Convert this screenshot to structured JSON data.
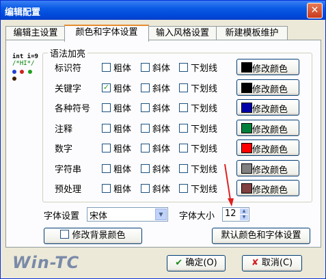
{
  "window": {
    "title": "编辑配置",
    "close_glyph": "✕"
  },
  "tabs": [
    {
      "label": "编辑主设置"
    },
    {
      "label": "颜色和字体设置"
    },
    {
      "label": "输入风格设置"
    },
    {
      "label": "新建模板维护"
    }
  ],
  "logo": {
    "line1": "int i=9",
    "line2": "/*HI*/"
  },
  "group_title": "语法加亮",
  "option_labels": {
    "bold": "粗体",
    "italic": "斜体",
    "underline": "下划线",
    "color_button": "修改颜色"
  },
  "rows": [
    {
      "label": "标识符",
      "bold": false,
      "swatch": "#000000"
    },
    {
      "label": "关键字",
      "bold": true,
      "swatch": "#000000"
    },
    {
      "label": "各种符号",
      "bold": false,
      "swatch": "#0000a8"
    },
    {
      "label": "注释",
      "bold": false,
      "swatch": "#00803a"
    },
    {
      "label": "数字",
      "bold": false,
      "swatch": "#ff0000"
    },
    {
      "label": "字符串",
      "bold": false,
      "swatch": "#808080"
    },
    {
      "label": "预处理",
      "bold": false,
      "swatch": "#804040"
    }
  ],
  "font_settings": {
    "font_label": "字体设置",
    "font_value": "宋体",
    "size_label": "字体大小",
    "size_value": "12"
  },
  "background_checkbox_label": "修改背景颜色",
  "default_button": "默认颜色和字体设置",
  "branding": "Win-TC",
  "ok_button": "确定(O)",
  "cancel_button": "取消(C)",
  "colors": {
    "annotation_arrow": "#e02020",
    "tab_highlight": "#e68b2c"
  }
}
